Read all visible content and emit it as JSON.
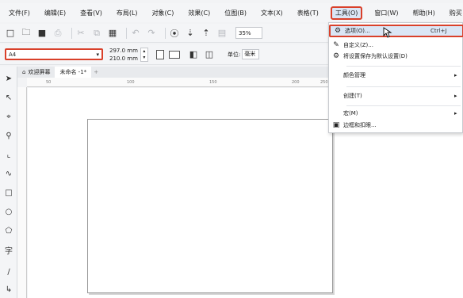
{
  "menubar": {
    "items": [
      {
        "label": "文件(F)"
      },
      {
        "label": "编辑(E)"
      },
      {
        "label": "查看(V)"
      },
      {
        "label": "布局(L)"
      },
      {
        "label": "对象(C)"
      },
      {
        "label": "效果(C)"
      },
      {
        "label": "位图(B)"
      },
      {
        "label": "文本(X)"
      },
      {
        "label": "表格(T)"
      },
      {
        "label": "工具(O)"
      },
      {
        "label": "窗口(W)"
      },
      {
        "label": "帮助(H)"
      },
      {
        "label": "购买"
      }
    ]
  },
  "toolbar": {
    "zoom": "35%"
  },
  "property_bar": {
    "paper_size": "A4",
    "width": "297.0 mm",
    "height": "210.0 mm",
    "unit_label": "单位:",
    "unit_value": "毫米"
  },
  "tabs": [
    {
      "label": "欢迎屏幕"
    },
    {
      "label": "未命名 -1*"
    }
  ],
  "ruler_ticks": [
    "50",
    "100",
    "150",
    "200",
    "250"
  ],
  "tools_menu": {
    "items": [
      {
        "label": "选项(O)...",
        "shortcut": "Ctrl+J"
      },
      {
        "label": "自定义(Z)..."
      },
      {
        "label": "将设置保存为默认设置(D)"
      },
      {
        "label": "颜色管理"
      },
      {
        "label": "创建(T)"
      },
      {
        "label": "宏(M)"
      },
      {
        "label": "边框和扣眼..."
      }
    ]
  }
}
